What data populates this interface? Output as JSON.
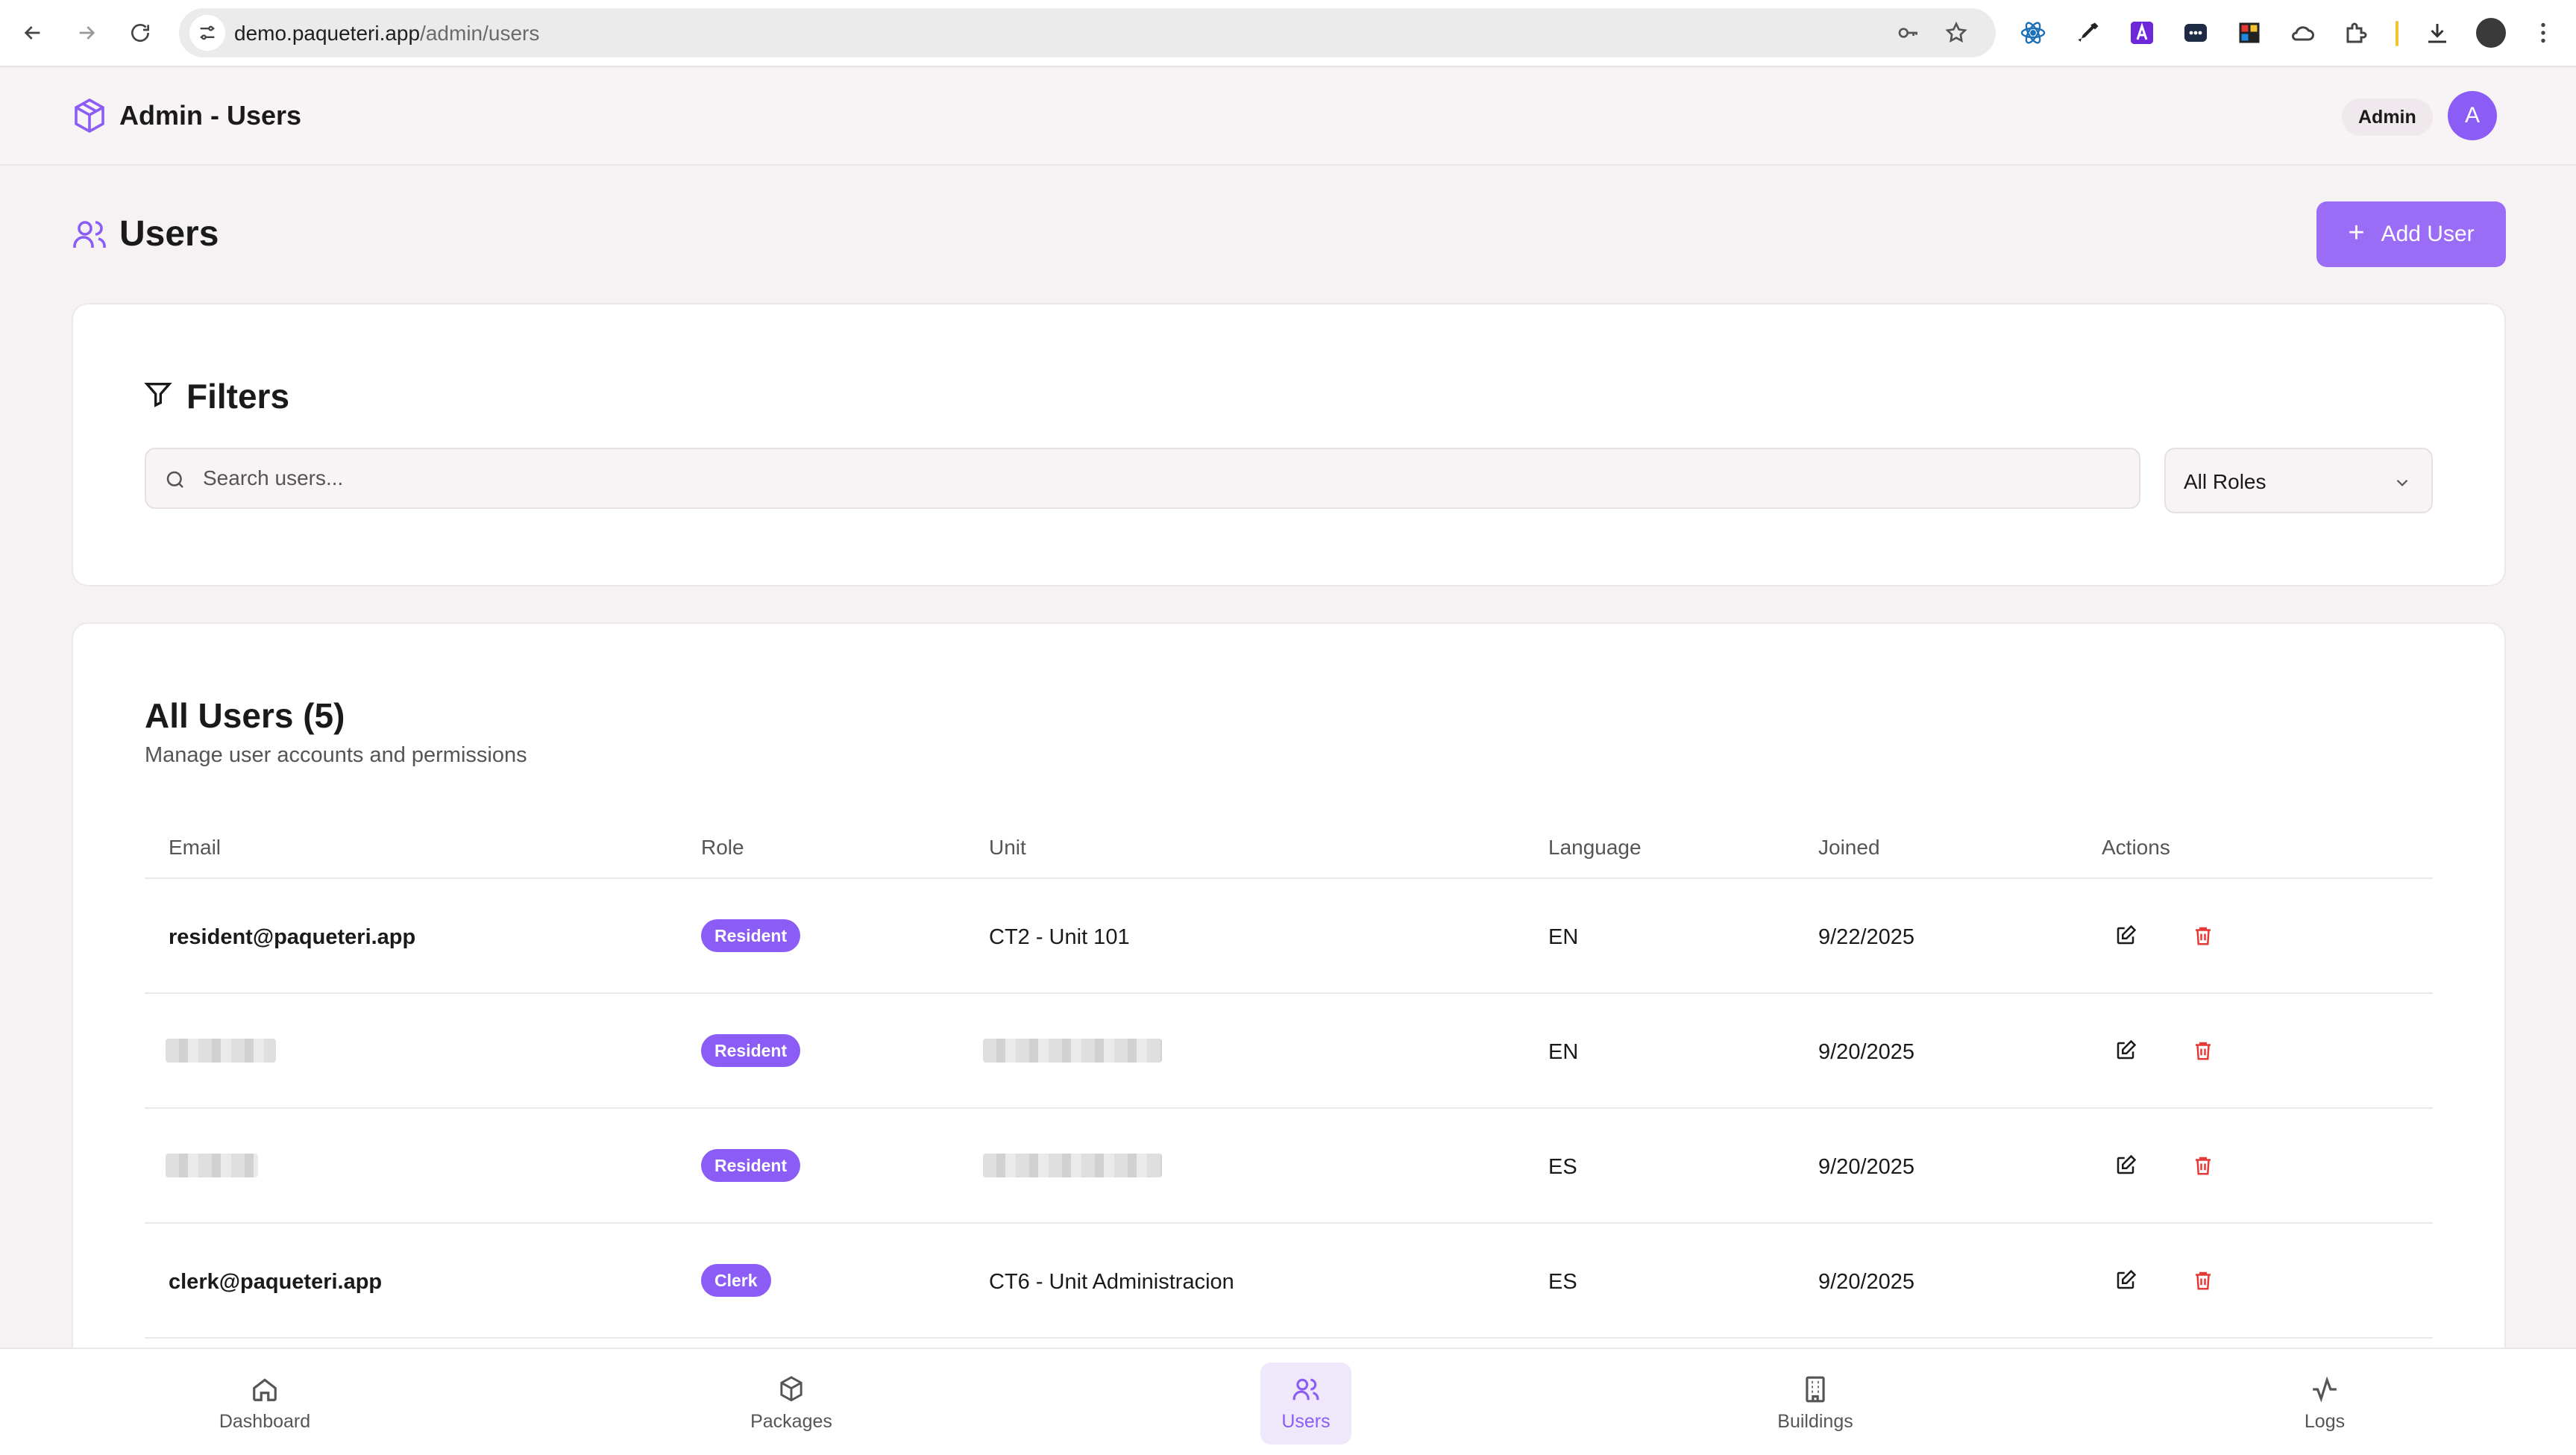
{
  "browser": {
    "url_host": "demo.paqueteri.app",
    "url_path": "/admin/users"
  },
  "header": {
    "title": "Admin - Users",
    "role_pill": "Admin",
    "avatar_initial": "A"
  },
  "page": {
    "title": "Users",
    "add_button_label": "Add User"
  },
  "filters": {
    "title": "Filters",
    "search_placeholder": "Search users...",
    "role_select_value": "All Roles"
  },
  "users_table": {
    "title": "All Users (5)",
    "subtitle": "Manage user accounts and permissions",
    "columns": [
      "Email",
      "Role",
      "Unit",
      "Language",
      "Joined",
      "Actions"
    ],
    "rows": [
      {
        "email": "resident@paqueteri.app",
        "role": "Resident",
        "unit": "CT2 - Unit 101",
        "language": "EN",
        "joined": "9/22/2025",
        "redacted": false
      },
      {
        "email": "",
        "role": "Resident",
        "unit": "",
        "language": "EN",
        "joined": "9/20/2025",
        "redacted": true
      },
      {
        "email": "",
        "role": "Resident",
        "unit": "",
        "language": "ES",
        "joined": "9/20/2025",
        "redacted": true
      },
      {
        "email": "clerk@paqueteri.app",
        "role": "Clerk",
        "unit": "CT6 - Unit Administracion",
        "language": "ES",
        "joined": "9/20/2025",
        "redacted": false
      }
    ]
  },
  "bottom_nav": {
    "items": [
      {
        "label": "Dashboard",
        "icon": "home-icon",
        "active": false
      },
      {
        "label": "Packages",
        "icon": "package-icon",
        "active": false
      },
      {
        "label": "Users",
        "icon": "users-icon",
        "active": true
      },
      {
        "label": "Buildings",
        "icon": "building-icon",
        "active": false
      },
      {
        "label": "Logs",
        "icon": "activity-icon",
        "active": false
      }
    ]
  },
  "colors": {
    "accent": "#8b5cf6",
    "delete": "#e53935",
    "background": "#f6f2f4"
  }
}
